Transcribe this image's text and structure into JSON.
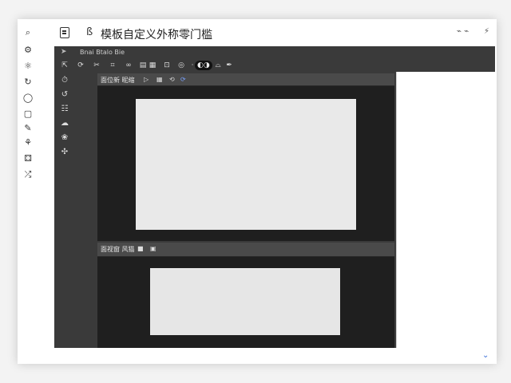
{
  "titlebar": {
    "title": "模板自定义外称零门槛",
    "control_left": "⌁ ⌁",
    "control_right": "⚡"
  },
  "editor": {
    "menu_text": "Bnai Btalo Bie",
    "pane1": {
      "title": "面位新 昵缩"
    },
    "pane2": {
      "title": "面视窗 风猫"
    }
  },
  "icons": {
    "left_rail": [
      "search-icon",
      "settings-icon",
      "gear-icon",
      "refresh-icon",
      "chat-icon",
      "document-icon",
      "tag-icon",
      "brush-icon",
      "extension-icon",
      "share-icon"
    ],
    "titlebar": [
      "document-icon",
      "user-icon"
    ]
  }
}
